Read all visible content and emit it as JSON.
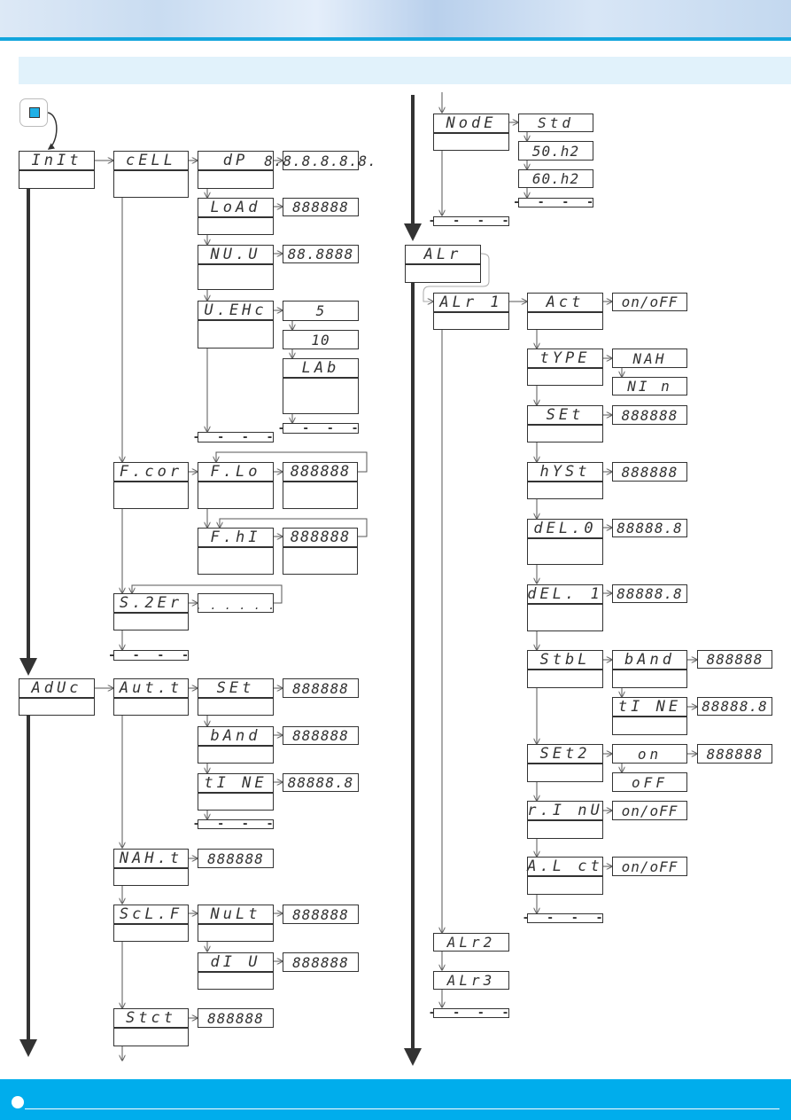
{
  "header": {
    "accent_color": "#12a5dd",
    "banner_color": "#e1f2fb"
  },
  "footer": {
    "color": "#00adec"
  },
  "start": {
    "icon": "enter-key-icon",
    "color": "#1fb0e6"
  },
  "end_marker": "- - - -",
  "left_column": {
    "init": {
      "label": "InIt"
    },
    "cell": {
      "label": "cELL"
    },
    "dp": {
      "label": "dP",
      "value": "8.8.8.8.8.8."
    },
    "load": {
      "label": "LoAd",
      "value": "888888"
    },
    "nuu": {
      "label": "NU.U",
      "value": "88.8888"
    },
    "vexc": {
      "label": "U.EHc",
      "options": [
        "5",
        "10",
        "LAb"
      ]
    },
    "fcor": {
      "label": "F.cor"
    },
    "flo": {
      "label": "F.Lo",
      "value": "888888"
    },
    "fhi": {
      "label": "F.hI",
      "value": "888888"
    },
    "szer": {
      "label": "S.2Er",
      "value": ". . . . . ."
    },
    "advc": {
      "label": "AdUc"
    },
    "autt": {
      "label": "Aut.t"
    },
    "set": {
      "label": "SEt",
      "value": "888888"
    },
    "band": {
      "label": "bAnd",
      "value": "888888"
    },
    "time": {
      "label": "tI NE",
      "value": "88888.8"
    },
    "maxt": {
      "label": "NAH.t",
      "value": "888888"
    },
    "sclf": {
      "label": "ScL.F"
    },
    "mult": {
      "label": "NuLt",
      "value": "888888"
    },
    "div": {
      "label": "dI U",
      "value": "888888"
    },
    "stct": {
      "label": "Stct",
      "value": "888888"
    }
  },
  "right_column": {
    "mode": {
      "label": "NodE",
      "options": [
        "Std",
        "50.h2",
        "60.h2"
      ]
    },
    "alr": {
      "label": "ALr"
    },
    "alr1": {
      "label": "ALr 1"
    },
    "act": {
      "label": "Act",
      "value": "on/oFF"
    },
    "type": {
      "label": "tYPE",
      "options": [
        "NAH",
        "NI n"
      ]
    },
    "set": {
      "label": "SEt",
      "value": "888888"
    },
    "hyst": {
      "label": "hYSt",
      "value": "888888"
    },
    "del0": {
      "label": "dEL.0",
      "value": "88888.8"
    },
    "del1": {
      "label": "dEL. 1",
      "value": "88888.8"
    },
    "stbl": {
      "label": "StbL"
    },
    "stbl_band": {
      "label": "bAnd",
      "value": "888888"
    },
    "stbl_time": {
      "label": "tI NE",
      "value": "88888.8"
    },
    "set2": {
      "label": "SEt2",
      "options": [
        "on",
        "oFF"
      ],
      "value": "888888"
    },
    "rinv": {
      "label": "r.I nU",
      "value": "on/oFF"
    },
    "alct": {
      "label": "A.L ct",
      "value": "on/oFF"
    },
    "alr2": {
      "label": "ALr2"
    },
    "alr3": {
      "label": "ALr3"
    }
  }
}
